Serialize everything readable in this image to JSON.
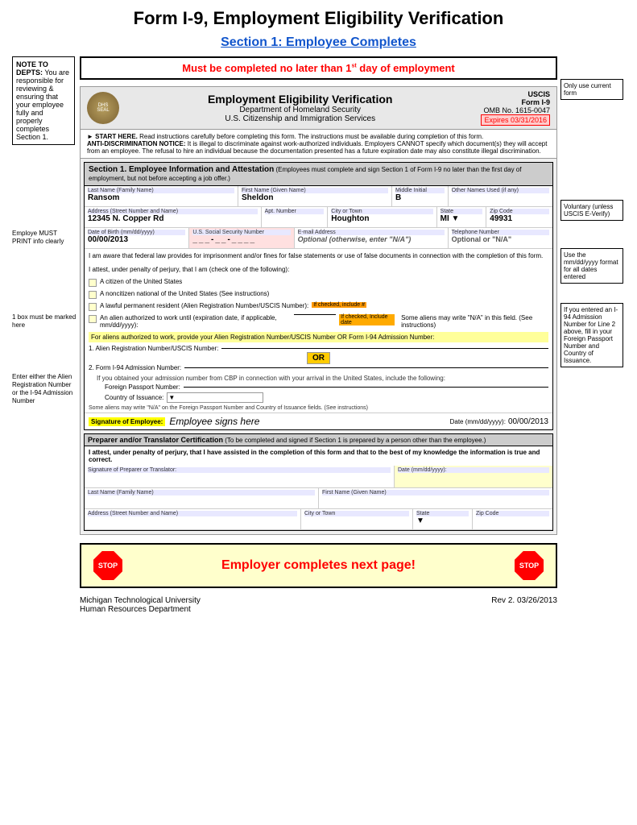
{
  "page": {
    "title": "Form I-9, Employment Eligibility Verification",
    "section_heading": "Section 1: Employee Completes"
  },
  "note_to_depts": {
    "label": "NOTE TO DEPTS:",
    "text": "You are responsible for reviewing & ensuring that your employee fully and properly completes Section 1."
  },
  "must_complete": {
    "text": "Must be completed no later than 1",
    "superscript": "st",
    "text2": " day of employment"
  },
  "form_header": {
    "seal_label": "DHS Seal",
    "title": "Employment Eligibility Verification",
    "dept": "Department of Homeland Security",
    "agency": "U.S. Citizenship and Immigration Services",
    "uscis_label": "USCIS",
    "form_label": "Form I-9",
    "omb": "OMB No. 1615-0047",
    "expires": "Expires 03/31/2016"
  },
  "only_use": "Only use current form",
  "form_notice": {
    "start_here": "START HERE.",
    "start_text": " Read instructions carefully before completing this form. The instructions must be available during completion of this form.",
    "antidisc": "ANTI-DISCRIMINATION NOTICE:",
    "antidisc_text": " It is illegal to discriminate against work-authorized individuals. Employers CANNOT specify which document(s) they will accept from an employee. The refusal to hire an individual because the documentation presented has a future expiration date may also constitute illegal discrimination."
  },
  "section1": {
    "title": "Section 1. Employee Information and Attestation",
    "title_sub": " (Employees must complete and sign Section 1 of Form I-9 no later than the first day of employment, but not before accepting a job offer.)",
    "fields": {
      "last_name_label": "Last Name (Family Name)",
      "last_name_value": "Ransom",
      "first_name_label": "First Name (Given Name)",
      "first_name_value": "Sheldon",
      "middle_initial_label": "Middle Initial",
      "middle_initial_value": "B",
      "other_names_label": "Other Names Used (if any)",
      "address_label": "Address (Street Number and Name)",
      "address_value": "12345 N. Copper Rd",
      "apt_label": "Apt. Number",
      "city_label": "City or Town",
      "city_value": "Houghton",
      "state_label": "State",
      "state_value": "MI",
      "zip_label": "Zip Code",
      "zip_value": "49931",
      "dob_label": "Date of Birth (mm/dd/yyyy)",
      "dob_value": "00/00/2013",
      "ssn_label": "U.S. Social Security Number",
      "email_label": "E-mail Address",
      "email_placeholder": "Optional (otherwise, enter \"N/A\")",
      "phone_label": "Telephone Number",
      "phone_placeholder": "Optional or \"N/A\""
    }
  },
  "attestation": {
    "aware_text": "I am aware that federal law provides for imprisonment and/or fines for false statements or use of false documents in connection with the completion of this form.",
    "attest_text": "I attest, under penalty of perjury, that I am (check one of the following):",
    "checkbox1": "A citizen of the United States",
    "checkbox2": "A noncitizen national of the United States (See instructions)",
    "checkbox3": "A lawful permanent resident (Alien Registration Number/USCIS Number):",
    "if_checked_label": "If checked, include #",
    "checkbox4": "An alien authorized to work until (expiration date, if applicable, mm/dd/yyyy):",
    "if_checked_date": "If checked, Include date",
    "some_aliens": "Some aliens may write \"N/A\" in this field. (See instructions)"
  },
  "alien_fields": {
    "intro": "For aliens authorized to work, provide your Alien Registration Number/USCIS Number OR Form I-94 Admission Number:",
    "line1_label": "1. Alien Registration Number/USCIS Number:",
    "or_label": "OR",
    "line2_label": "2. Form I-94 Admission Number:",
    "i94_note": "If you obtained your admission number from CBP in connection with your arrival in the United States, include the following:",
    "foreign_passport_label": "Foreign Passport Number:",
    "country_label": "Country of Issuance:",
    "some_aliens_note": "Some aliens may write \"N/A\" on the Foreign Passport Number and Country of Issuance fields. (See instructions)"
  },
  "signature_row": {
    "sig_label": "Signature of Employee:",
    "sig_value": "Employee signs here",
    "date_label": "Date (mm/dd/yyyy):",
    "date_value": "00/00/2013"
  },
  "preparer": {
    "title": "Preparer and/or Translator Certification",
    "title_sub": " (To be completed and signed if Section 1 is prepared by a person other than the employee.)",
    "attest_text": "I attest, under penalty of perjury, that I have assisted in the completion of this form and that to the best of my knowledge the information is true and correct.",
    "sig_label": "Signature of Preparer or Translator:",
    "date_label": "Date (mm/dd/yyyy):",
    "last_name_label": "Last Name (Family Name)",
    "first_name_label": "First Name (Given Name)",
    "address_label": "Address (Street Number and Name)",
    "city_label": "City or Town",
    "state_label": "State",
    "zip_label": "Zip Code"
  },
  "annotations": {
    "employee_must": "Employe MUST PRINT info clearly",
    "one_box": "1 box must be marked here",
    "enter_alien": "Enter either the Alien Registration Number or the I-94 Admission Number",
    "voluntary": "Voluntary (unless USCIS E-Verify)",
    "use_mmddyyyy": "Use the mm/dd/yyyy format for all dates entered",
    "admission_note": "If you entered an I-94 Admission Number for Line 2 above, fill in your Foreign Passport Number and Country of Issuance."
  },
  "bottom_bar": {
    "stop_label": "STOP",
    "employer_text": "Employer completes next page!"
  },
  "footer": {
    "university": "Michigan Technological University",
    "dept": "Human Resources Department",
    "rev": "Rev 2. 03/26/2013"
  }
}
